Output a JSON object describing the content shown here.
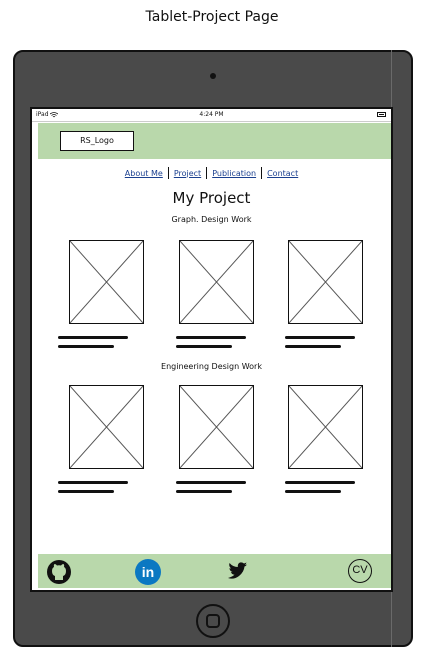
{
  "page": {
    "title": "Tablet-Project Page"
  },
  "status_bar": {
    "device": "iPad",
    "time": "4:24 PM"
  },
  "header": {
    "logo": "RS_Logo"
  },
  "nav": {
    "items": [
      "About Me",
      "Project",
      "Publication",
      "Contact"
    ]
  },
  "main": {
    "title": "My Project",
    "sections": [
      {
        "title": "Graph. Design Work"
      },
      {
        "title": "Engineering Design Work"
      }
    ]
  },
  "footer": {
    "icons": [
      "github-icon",
      "linkedin-icon",
      "twitter-icon",
      "cv-icon"
    ],
    "cv_label": "CV",
    "linkedin_label": "in"
  },
  "colors": {
    "band": "#b9d8ab",
    "link": "#1a3f8f",
    "linkedin": "#0b78c2",
    "device": "#4a4a4a"
  }
}
